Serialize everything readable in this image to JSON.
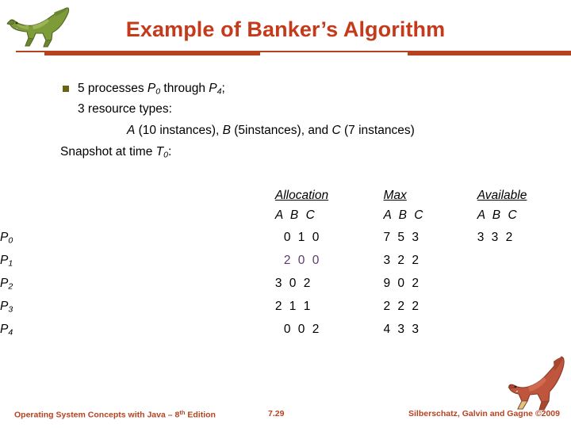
{
  "slide": {
    "title": "Example of Banker’s Algorithm",
    "title_color": "#C43A1B",
    "rule_color": "#B7421F",
    "bullet_color": "#666611",
    "highlight_color": "#5B3A6E"
  },
  "body": {
    "processes_line": {
      "prefix": "5 processes ",
      "var1": "P",
      "var1_sub": "0",
      "middle": " through ",
      "var2": "P",
      "var2_sub": "4",
      "suffix": ";"
    },
    "resource_types_line": "3 resource types:",
    "instances_line": {
      "a_var": "A",
      "a_text": " (10 instances),  ",
      "b_var": "B",
      "b_text": " (5instances), and ",
      "c_var": "C",
      "c_text": " (7 instances)"
    },
    "snapshot_line": {
      "prefix": "Snapshot at time ",
      "var": "T",
      "var_sub": "0",
      "suffix": ":"
    }
  },
  "table": {
    "headers": {
      "allocation": "Allocation",
      "max": "Max",
      "available": "Available"
    },
    "subheaders": {
      "allocation": "A B C",
      "max": "A B C",
      "available": "A B C"
    },
    "rows": [
      {
        "pid_var": "P",
        "pid_sub": "0",
        "allocation": "0 1 0",
        "allocation_indent": true,
        "allocation_highlight": false,
        "max": "7 5 3",
        "available": "3 3 2"
      },
      {
        "pid_var": "P",
        "pid_sub": "1",
        "allocation": "2 0 0",
        "allocation_indent": true,
        "allocation_highlight": true,
        "max": "3 2 2",
        "available": ""
      },
      {
        "pid_var": "P",
        "pid_sub": "2",
        "allocation": "3 0 2",
        "allocation_indent": false,
        "allocation_highlight": false,
        "max": "9 0 2",
        "available": ""
      },
      {
        "pid_var": "P",
        "pid_sub": "3",
        "allocation": "2 1 1",
        "allocation_indent": false,
        "allocation_highlight": false,
        "max": "2 2 2",
        "available": ""
      },
      {
        "pid_var": "P",
        "pid_sub": "4",
        "allocation": "0 0 2",
        "allocation_indent": true,
        "allocation_highlight": false,
        "max": "4 3 3",
        "available": ""
      }
    ]
  },
  "footer": {
    "left_pre": "Operating System Concepts with Java – 8",
    "left_sup": "th",
    "left_post": " Edition",
    "page": "7.29",
    "right": "Silberschatz, Galvin and Gagne ©2009"
  }
}
